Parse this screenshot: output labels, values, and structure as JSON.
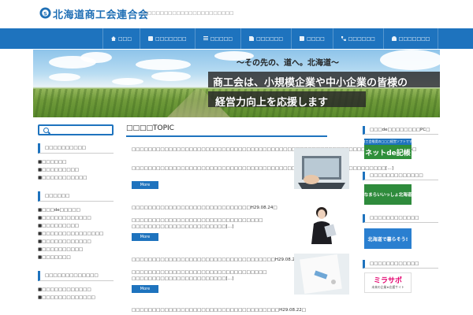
{
  "header": {
    "title": "北海道商工会連合会",
    "tagline": "□□□□□□□□□□□□□□□□□□□□□□"
  },
  "nav": {
    "items": [
      {
        "label": "□□□",
        "icon": "home-icon"
      },
      {
        "label": "□□□□□□□",
        "icon": "doc-icon"
      },
      {
        "label": "□□□□□",
        "icon": "list-icon"
      },
      {
        "label": "□□□□□□",
        "icon": "file-icon"
      },
      {
        "label": "□□□□",
        "icon": "book-icon"
      },
      {
        "label": "□□□□□□",
        "icon": "phone-icon"
      },
      {
        "label": "□□□□□□□",
        "icon": "user-icon"
      }
    ]
  },
  "hero": {
    "sub": "〜その先の、道へ。北海道〜",
    "line1": "商工会は、小規模企業や中小企業の皆様の",
    "line2": "経営力向上を応援します"
  },
  "left_sidebar": {
    "sections": [
      {
        "heading": "□□□□□□□□□□",
        "links": [
          "■□□□□□□",
          "■□□□□□□□□□",
          "■□□□□□□□□□□□"
        ]
      },
      {
        "heading": "□□□□□□",
        "links": [
          "■□□□de□□□□□",
          "■□□□□□□□□□□□□",
          "■□□□□□□□□□",
          "■□□□□□□□□□□□□□□□",
          "■□□□□□□□□□□□□",
          "■□□□□□□□□□□",
          "■□□□□□□□"
        ]
      },
      {
        "heading": "□□□□□□□□□□□□□",
        "links": [
          "■□□□□□□□□□□□□",
          "■□□□□□□□□□□□□□"
        ]
      }
    ]
  },
  "main": {
    "title": "□□□□TOPIC",
    "more_label": "More",
    "posts": [
      {
        "title": "□□□□□□□□□□□□□□□□□□□□□□□□□□□□□□□□□□□□□□□□□□□□□□□□□□□□□□□□□□□□□□□H29.09.15□",
        "body": "□□□□□□□□□□□□□□□□□□□□□□□□□□□□□□□□□□□□□□□□□□□□□□□□□□□□□□□□□□□□□□[…]"
      },
      {
        "title": "□□□□□□□□□□□□□□□□□□□□□□□□□□□□□H29.08.24□",
        "body": "□□□□□□□□□□□□□□□□□□□□□□□□□□□□□□□□ □□□□□□□□□□□□□□□□□□□□□□□[…]"
      },
      {
        "title": "□□□□□□□□□□□□□□□□□□□□□□□□□□□□□□□□□□□H29.08.24□",
        "body": "□□□□□□□□□□□□□□□□□□□□□□□□□□□□□□□□□ □□□□□□□□□□□□□□□□□□□□□□□[…]"
      },
      {
        "title": "□□□□□□□□□□□□□□□□□□□□□□□□□□□□□□□□□□□□H29.08.22□",
        "body": ""
      }
    ]
  },
  "right_sidebar": {
    "sections": [
      {
        "heading": "□□□de□□□□□□□□PC□",
        "banner_top": "商工会推奨の□□□経営ソフトです!",
        "banner_main": "ネットde記帳"
      },
      {
        "heading": "□□□□□□□□□□□□□",
        "banner_main": "なまらいいっしょ北海道"
      },
      {
        "heading": "□□□□□□□□□□□□",
        "banner_main": "北海道で暮らそう!"
      },
      {
        "heading": "□□□□□□□□□□□□",
        "banner_main": "ミラサポ",
        "banner_sub": "未来の企業★応援サイト"
      }
    ]
  },
  "colors": {
    "accent": "#1e73be"
  }
}
